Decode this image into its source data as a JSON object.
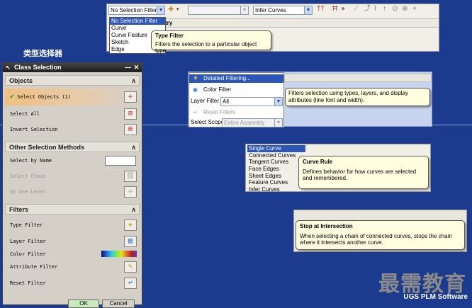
{
  "heading": "类型选择器",
  "toolbar": {
    "filter_value": "No Selection Filter",
    "filter_options": [
      "No Selection Filter",
      "Curve",
      "Curve Feature",
      "Sketch",
      "Edge"
    ],
    "middle_value": "",
    "curve_rule_value": "Infer Curves",
    "header_text": "try",
    "tooltip_title": "Type Filter",
    "tooltip_text": "Filters the selection to a particular object type.",
    "icons": [
      "select-arrow-icon",
      "dropdown-icon",
      "snap-cross-icon",
      "snap-cross-2-icon",
      "snap-point-icon",
      "line-icon",
      "arc-icon",
      "curve-icon",
      "arrow-up-icon",
      "circle-target-icon",
      "circle-cross-icon",
      "plus-icon"
    ]
  },
  "dialog": {
    "title": "Class Selection",
    "objects_title": "Objects",
    "select_objects": "Select Objects (1)",
    "select_all": "Select All",
    "invert_selection": "Invert Selection",
    "other_title": "Other Selection Methods",
    "select_by_name": "Select by Name",
    "select_chain": "Select Chain",
    "up_one_level": "Up One Level",
    "filters_title": "Filters",
    "type_filter": "Type Filter",
    "layer_filter": "Layer Filter",
    "color_filter": "Color Filter",
    "attribute_filter": "Attribute Filter",
    "reset_filter": "Reset Filter",
    "ok": "OK",
    "cancel": "Cancel"
  },
  "detailed": {
    "items": [
      "Detailed Filtering...",
      "Color Filter",
      "Reset Filters"
    ],
    "layer_filter_label": "Layer Filter",
    "layer_filter_value": "All",
    "select_scope_label": "Select Scope",
    "select_scope_value": "Entire Assembly",
    "tooltip_text": "Filters selection using types, layers, and display attributes (line font and width)."
  },
  "curve_rule": {
    "options": [
      "Single Curve",
      "Connected Curves",
      "Tangent Curves",
      "Face Edges",
      "Sheet Edges",
      "Feature Curves",
      "Infer Curves"
    ],
    "tooltip_title": "Curve Rule",
    "tooltip_text": "Defines behavior for how curves are selected and remembered."
  },
  "stop_intersection": {
    "tooltip_title": "Stop at Intersection",
    "tooltip_text": "When selecting a chain of connected curves, stops the chain where it intersects another curve."
  },
  "watermark": "最需教育",
  "brand": "UGS PLM Software"
}
